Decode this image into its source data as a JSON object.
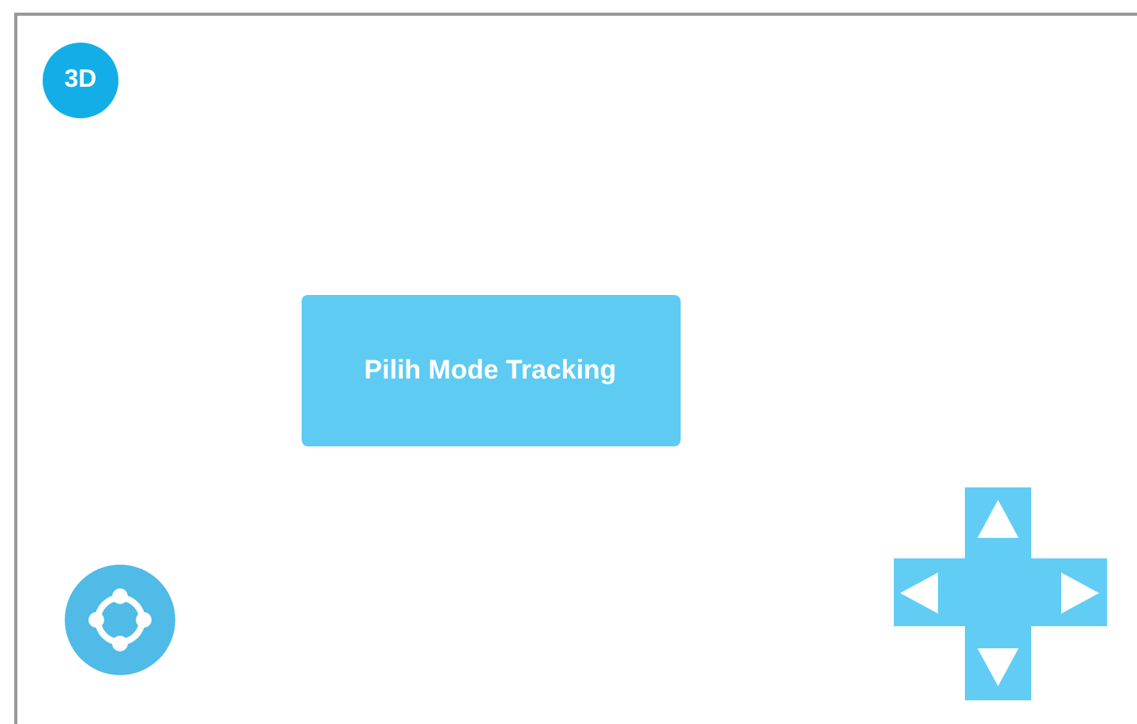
{
  "mode_button": {
    "label": "3D"
  },
  "tracking_button": {
    "label": "Pilih Mode Tracking"
  }
}
